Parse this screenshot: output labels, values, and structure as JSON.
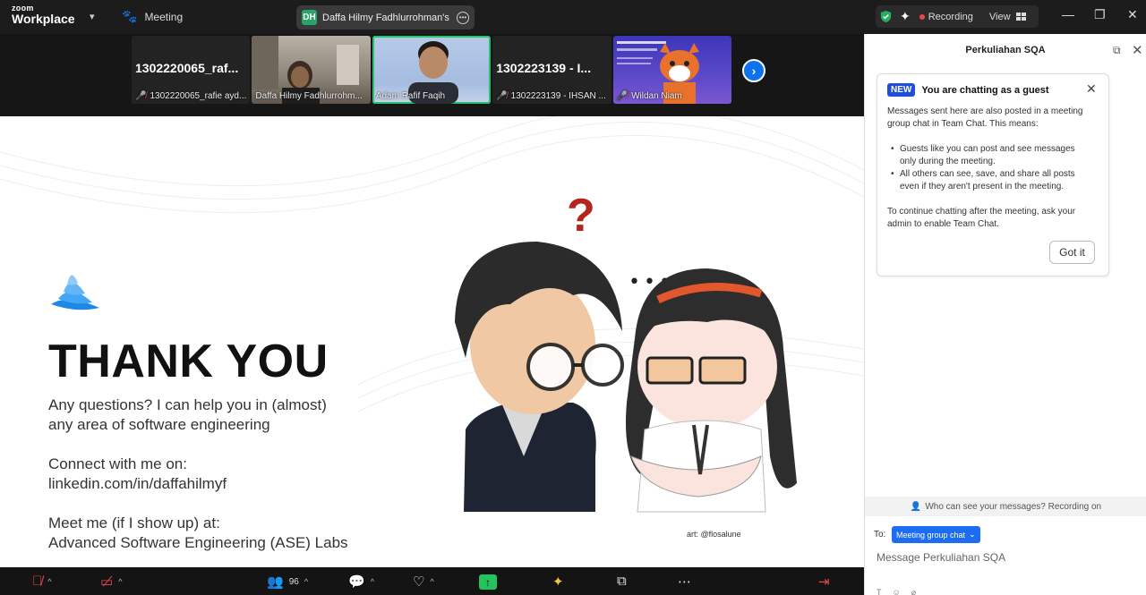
{
  "app": {
    "logo_small": "zoom",
    "logo_big": "Workplace"
  },
  "titlebar": {
    "meeting_label": "Meeting",
    "share_initials": "DH",
    "share_title": "Daffa Hilmy Fadhlurrohman's scr",
    "recording_label": "Recording",
    "view_label": "View",
    "status_colors": {
      "recording": "#e5484d",
      "secure": "#27ae60"
    }
  },
  "participants": [
    {
      "name": "1302220065_raf...",
      "label": "1302220065_rafie ayd...",
      "muted": true,
      "video": false
    },
    {
      "name": "",
      "label": "Daffa Hilmy Fadhlurrohm...",
      "muted": false,
      "video": true
    },
    {
      "name": "",
      "label": "Adam Rafif Faqih",
      "muted": false,
      "video": true,
      "active": true
    },
    {
      "name": "1302223139 - I...",
      "label": "1302223139 - IHSAN ...",
      "muted": true,
      "video": false
    },
    {
      "name": "",
      "label": "Wildan Niam",
      "muted": true,
      "video": true
    }
  ],
  "slide": {
    "heading": "THANK YOU",
    "line1": "Any questions? I can help you in (almost)",
    "line2": "any area of software engineering",
    "line3": "Connect with me on:",
    "line4": "linkedin.com/in/daffahilmyf",
    "line5": "Meet me (if I show up) at:",
    "line6": "Advanced Software Engineering (ASE) Labs",
    "art_credit": "art: @flosalune",
    "question_mark": "?",
    "dots": "•••"
  },
  "toolbar": {
    "participant_count": "96",
    "accent": "#24c35d"
  },
  "chat": {
    "title": "Perkuliahan SQA",
    "badge": "NEW",
    "notice_title": "You are chatting as a guest",
    "notice_p1": "Messages sent here are also posted in a meeting group chat in Team Chat. This means:",
    "bullet1": "Guests like you can post and see messages only during the meeting.",
    "bullet2": "All others can see, save, and share all posts even if they aren't present in the meeting.",
    "notice_p2": "To continue chatting after the meeting, ask your admin to enable Team Chat.",
    "got_it": "Got it",
    "who_can_see": "Who can see your messages? Recording on",
    "to_label": "To:",
    "to_value": "Meeting group chat",
    "message_placeholder": "Message Perkuliahan SQA"
  }
}
